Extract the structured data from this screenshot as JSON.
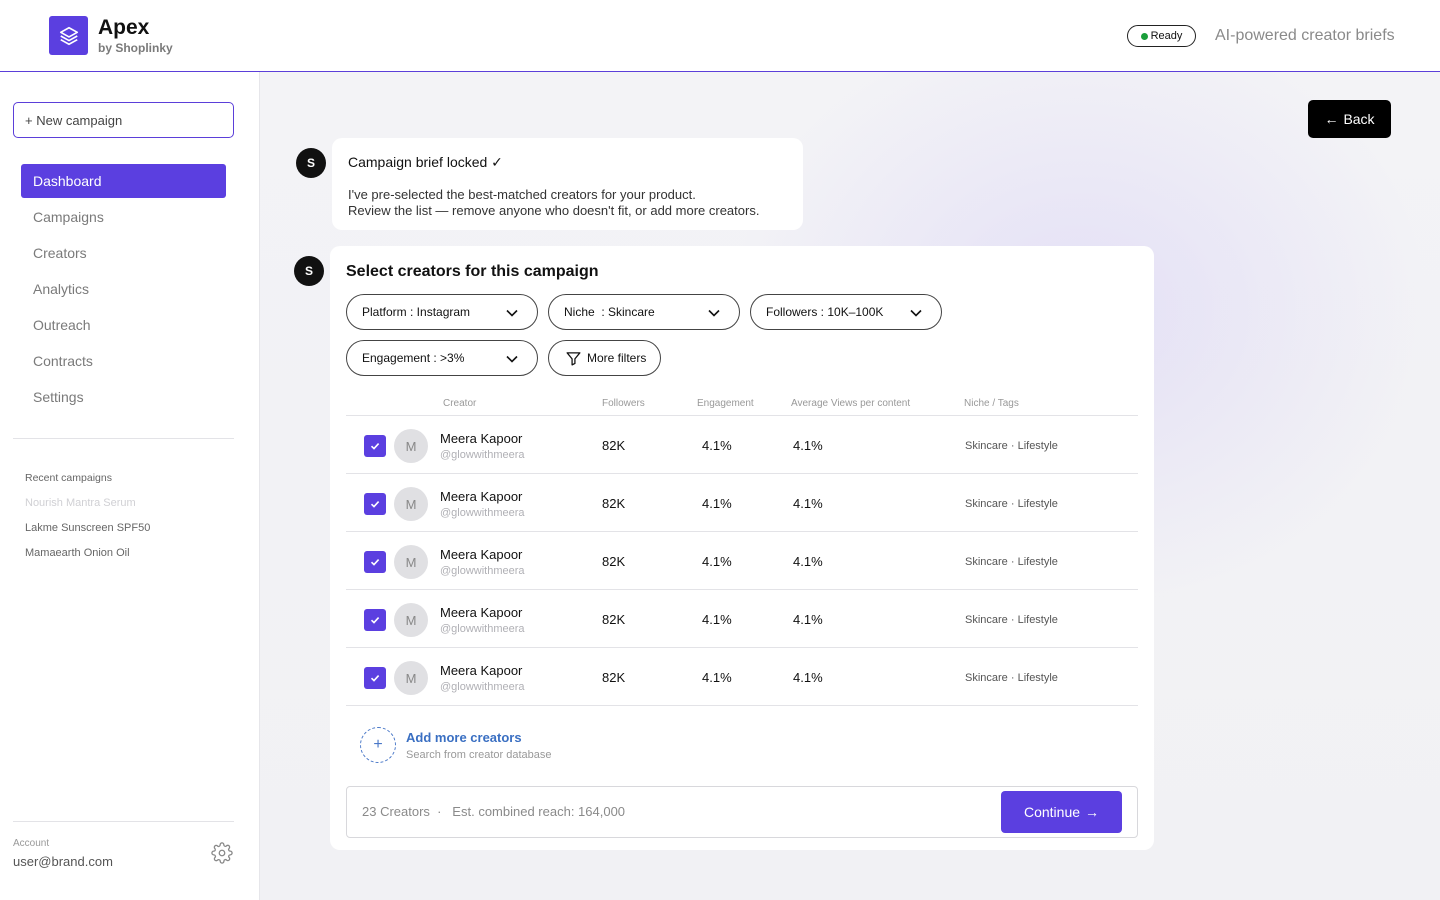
{
  "header": {
    "brand_name": "Apex",
    "brand_sub": "by Shoplinky",
    "status": "Ready",
    "tagline": "AI-powered creator briefs"
  },
  "sidebar": {
    "new_campaign": "+ New campaign",
    "nav": [
      {
        "label": "Dashboard",
        "active": true
      },
      {
        "label": "Campaigns"
      },
      {
        "label": "Creators"
      },
      {
        "label": "Analytics"
      },
      {
        "label": "Outreach"
      },
      {
        "label": "Contracts"
      },
      {
        "label": "Settings"
      }
    ],
    "recent_title": "Recent campaigns",
    "recent": [
      "Nourish Mantra Serum",
      "Lakme Sunscreen SPF50",
      "Mamaearth Onion Oil"
    ],
    "account_label": "Account",
    "account_email": "user@brand.com"
  },
  "main": {
    "back": "Back",
    "assistant_initial": "S",
    "brief": {
      "title": "Campaign brief locked ✓",
      "line1": "I've pre-selected the best-matched creators for your product.",
      "line2": "Review the list — remove anyone who doesn't fit, or add more creators."
    },
    "card": {
      "title": "Select creators for this campaign",
      "filters": {
        "platform": "Platform : Instagram",
        "niche": "Niche  : Skincare",
        "followers": "Followers : 10K–100K",
        "engagement": "Engagement : >3%",
        "more": "More filters"
      },
      "columns": {
        "creator": "Creator",
        "followers": "Followers",
        "engagement": "Engagement",
        "avg_views": "Average Views per content",
        "tags": "Niche / Tags"
      },
      "rows": [
        {
          "initial": "M",
          "name": "Meera Kapoor",
          "handle": "@glowwithmeera",
          "followers": "82K",
          "engagement": "4.1%",
          "avg_views": "4.1%",
          "tags": "Skincare · Lifestyle",
          "checked": true
        },
        {
          "initial": "M",
          "name": "Meera Kapoor",
          "handle": "@glowwithmeera",
          "followers": "82K",
          "engagement": "4.1%",
          "avg_views": "4.1%",
          "tags": "Skincare · Lifestyle",
          "checked": true
        },
        {
          "initial": "M",
          "name": "Meera Kapoor",
          "handle": "@glowwithmeera",
          "followers": "82K",
          "engagement": "4.1%",
          "avg_views": "4.1%",
          "tags": "Skincare · Lifestyle",
          "checked": true
        },
        {
          "initial": "M",
          "name": "Meera Kapoor",
          "handle": "@glowwithmeera",
          "followers": "82K",
          "engagement": "4.1%",
          "avg_views": "4.1%",
          "tags": "Skincare · Lifestyle",
          "checked": true
        },
        {
          "initial": "M",
          "name": "Meera Kapoor",
          "handle": "@glowwithmeera",
          "followers": "82K",
          "engagement": "4.1%",
          "avg_views": "4.1%",
          "tags": "Skincare · Lifestyle",
          "checked": true
        }
      ],
      "add_more": {
        "title": "Add more creators",
        "sub": "Search from creator database"
      },
      "footer": {
        "summary": "23 Creators  ·   Est. combined reach: 164,000",
        "continue": "Continue"
      }
    }
  },
  "colors": {
    "accent": "#5b3fe0",
    "link": "#3a6fc2",
    "ready_dot": "#1a9e3a"
  }
}
